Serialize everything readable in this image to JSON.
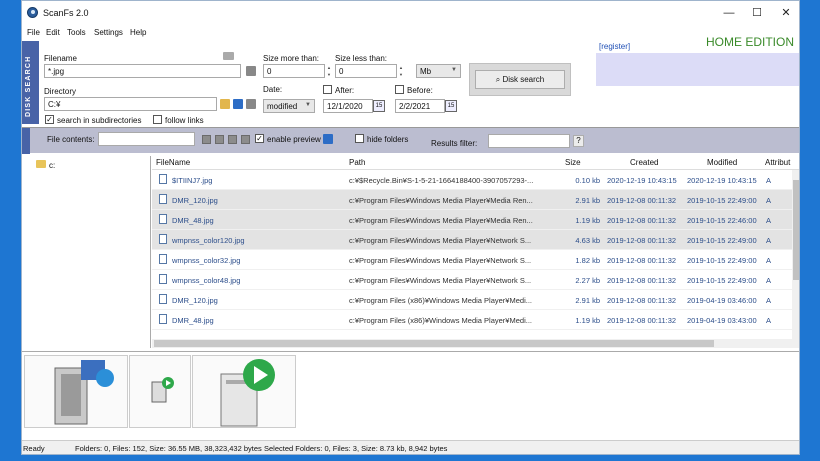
{
  "window": {
    "title": "ScanFs 2.0",
    "controls": {
      "minimize": "—",
      "maximize": "☐",
      "close": "✕"
    }
  },
  "menu": [
    "File",
    "Edit",
    "Tools",
    "Settings",
    "Help"
  ],
  "sidebar_tab": "DISK SEARCH",
  "search": {
    "filename_label": "Filename",
    "filename_value": "*.jpg",
    "directory_label": "Directory",
    "directory_value": "C:¥",
    "search_subdirs_label": "search in subdirectories",
    "search_subdirs_checked": true,
    "follow_links_label": "follow links",
    "follow_links_checked": false,
    "size_more_label": "Size more than:",
    "size_more_value": "0",
    "size_less_label": "Size less than:",
    "size_less_value": "0",
    "size_unit": "Mb",
    "date_label": "Date:",
    "date_mode": "modified",
    "after_label": "After:",
    "after_value": "12/1/2020",
    "before_label": "Before:",
    "before_value": "2/2/2021",
    "search_button": "Disk search"
  },
  "register_link": "[register]",
  "edition": "HOME EDITION",
  "filter_bar": {
    "file_contents_label": "File contents:",
    "file_contents_value": "",
    "enable_preview_label": "enable preview",
    "enable_preview_checked": true,
    "hide_folders_label": "hide folders",
    "hide_folders_checked": false,
    "results_filter_label": "Results filter:",
    "results_filter_value": "",
    "help_button": "?"
  },
  "tree": {
    "root": "c:"
  },
  "grid": {
    "columns": [
      "FileName",
      "Path",
      "Size",
      "Created",
      "Modified",
      "Attribut"
    ],
    "rows": [
      {
        "name": "$ITIINJ7.jpg",
        "path": "c:¥$Recycle.Bin¥S-1-5-21-1664188400-3907057293-...",
        "size": "0.10 kb",
        "created": "2020-12-19 10:43:15",
        "modified": "2020-12-19 10:43:15",
        "attr": "A",
        "selected": false
      },
      {
        "name": "DMR_120.jpg",
        "path": "c:¥Program Files¥Windows Media Player¥Media Ren...",
        "size": "2.91 kb",
        "created": "2019-12-08 00:11:32",
        "modified": "2019-10-15 22:49:00",
        "attr": "A",
        "selected": true
      },
      {
        "name": "DMR_48.jpg",
        "path": "c:¥Program Files¥Windows Media Player¥Media Ren...",
        "size": "1.19 kb",
        "created": "2019-12-08 00:11:32",
        "modified": "2019-10-15 22:46:00",
        "attr": "A",
        "selected": true
      },
      {
        "name": "wmpnss_color120.jpg",
        "path": "c:¥Program Files¥Windows Media Player¥Network S...",
        "size": "4.63 kb",
        "created": "2019-12-08 00:11:32",
        "modified": "2019-10-15 22:49:00",
        "attr": "A",
        "selected": true
      },
      {
        "name": "wmpnss_color32.jpg",
        "path": "c:¥Program Files¥Windows Media Player¥Network S...",
        "size": "1.82 kb",
        "created": "2019-12-08 00:11:32",
        "modified": "2019-10-15 22:49:00",
        "attr": "A",
        "selected": false
      },
      {
        "name": "wmpnss_color48.jpg",
        "path": "c:¥Program Files¥Windows Media Player¥Network S...",
        "size": "2.27 kb",
        "created": "2019-12-08 00:11:32",
        "modified": "2019-10-15 22:49:00",
        "attr": "A",
        "selected": false
      },
      {
        "name": "DMR_120.jpg",
        "path": "c:¥Program Files (x86)¥Windows Media Player¥Medi...",
        "size": "2.91 kb",
        "created": "2019-12-08 00:11:32",
        "modified": "2019-04-19 03:46:00",
        "attr": "A",
        "selected": false
      },
      {
        "name": "DMR_48.jpg",
        "path": "c:¥Program Files (x86)¥Windows Media Player¥Medi...",
        "size": "1.19 kb",
        "created": "2019-12-08 00:11:32",
        "modified": "2019-04-19 03:43:00",
        "attr": "A",
        "selected": false
      }
    ]
  },
  "status": {
    "ready": "Ready",
    "totals": "Folders: 0, Files: 152, Size: 36.55 MB, 38,323,432 bytes",
    "selected": "Selected Folders: 0, Files: 3, Size: 8.73 kb, 8,942 bytes"
  },
  "colors": {
    "accent": "#4863a7",
    "edition": "#3a8a2a",
    "link": "#1f4fb5"
  }
}
